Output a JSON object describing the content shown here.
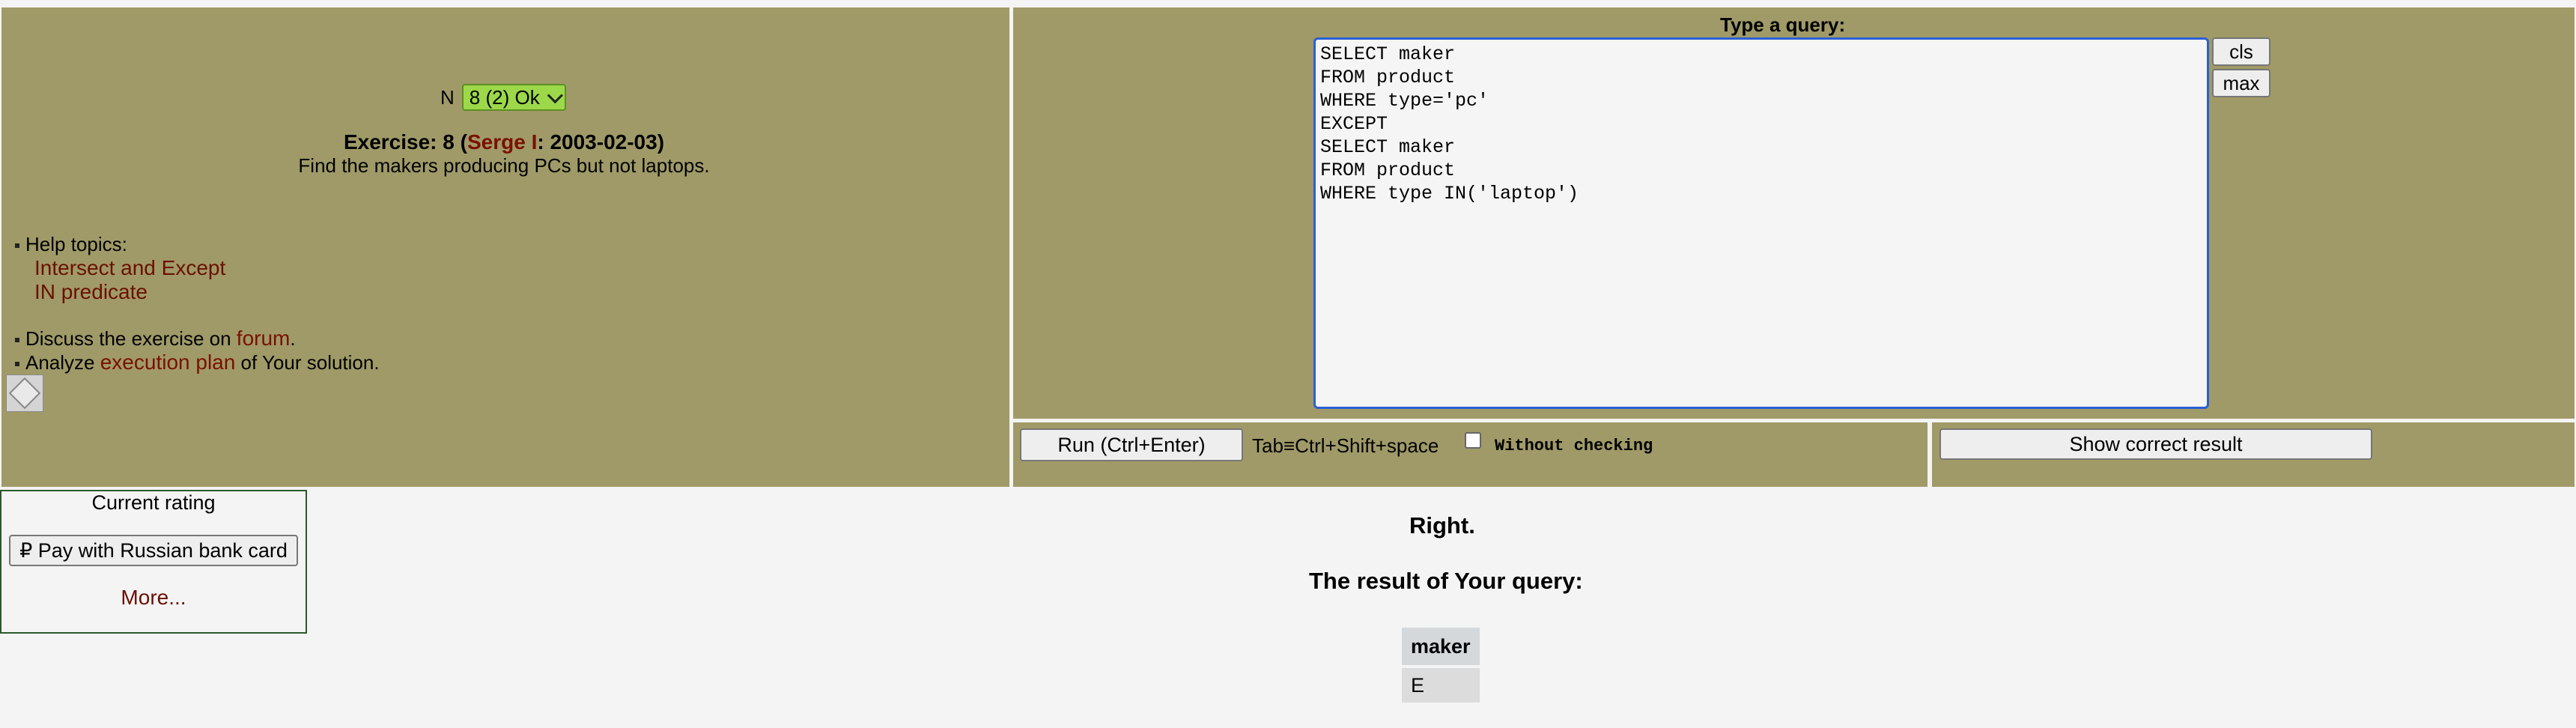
{
  "exercise": {
    "n_label": "N",
    "selector_value": "8 (2) Ok",
    "title_prefix": "Exercise: 8 (",
    "author": "Serge I",
    "title_suffix": ": 2003-02-03)",
    "task": "Find the makers producing PCs but not laptops."
  },
  "help": {
    "label": "Help topics:",
    "topics": [
      "Intersect and Except",
      "IN predicate"
    ],
    "discuss_prefix": "Discuss the exercise on ",
    "discuss_link": "forum",
    "discuss_suffix": ".",
    "analyze_prefix": "Analyze ",
    "analyze_link": "execution plan",
    "analyze_suffix": " of Your solution."
  },
  "editor": {
    "label": "Type a query:",
    "query": "SELECT maker\nFROM product\nWHERE type='pc'\nEXCEPT\nSELECT maker\nFROM product\nWHERE type IN('laptop')",
    "cls_label": "cls",
    "max_label": "max"
  },
  "controls": {
    "run_label": "Run (Ctrl+Enter)",
    "tab_hint": "Tab≡Ctrl+Shift+space",
    "without_checking": "Without checking",
    "show_result_label": "Show correct result"
  },
  "rating": {
    "title": "Current rating",
    "pay_label": "₽ Pay with Russian bank card",
    "more": "More..."
  },
  "result": {
    "status": "Right.",
    "title": "The result of Your query:",
    "columns": [
      "maker"
    ],
    "rows": [
      [
        "E"
      ]
    ]
  },
  "colors": {
    "panel": "#a09a68",
    "link": "#6a1000",
    "selector": "#9cd84a",
    "editor_border": "#2a5fd6"
  }
}
